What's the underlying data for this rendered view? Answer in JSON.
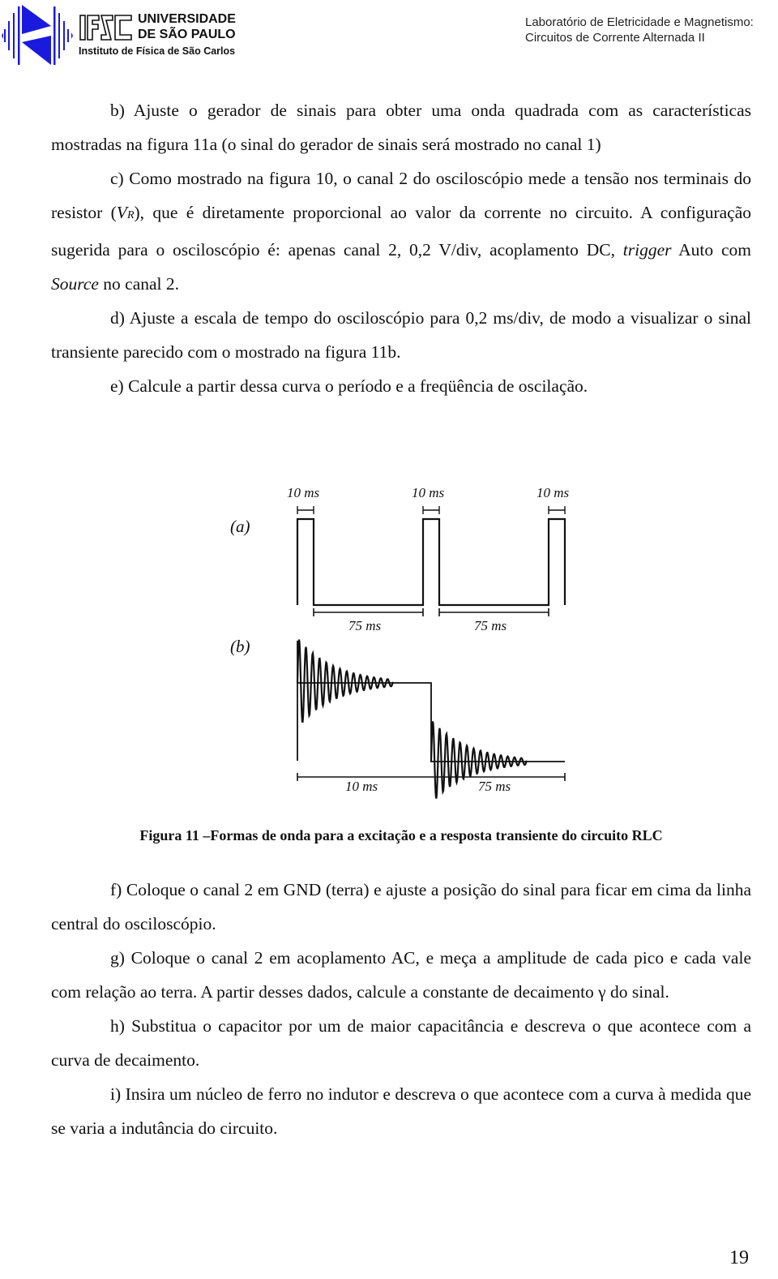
{
  "header": {
    "logo": {
      "acronym": "IFSC",
      "line1": "UNIVERSIDADE",
      "line2": "DE SÃO PAULO",
      "line3": "Instituto de Física de São Carlos",
      "color": "#1a1adf"
    },
    "course_line1": "Laboratório de Eletricidade e Magnetismo:",
    "course_line2": "Circuitos de Corrente Alternada II"
  },
  "paragraphs_top": {
    "b": "b) Ajuste o gerador de sinais para obter uma onda quadrada com as características mostradas na figura 11a (o sinal do gerador de sinais será mostrado no canal 1)",
    "c_pre": "c) Como mostrado na figura 10, o canal 2 do osciloscópio mede a tensão nos terminais do resistor (",
    "c_var": "V",
    "c_sub": "R",
    "c_mid": "), que é diretamente proporcional ao valor da corrente no circuito. A configuração sugerida para o osciloscópio é: apenas canal 2, 0,2 V/div, acoplamento DC, ",
    "c_trigger": "trigger",
    "c_mid2": " Auto com ",
    "c_source": "Source",
    "c_end": " no canal 2.",
    "d": "d) Ajuste a escala de tempo do osciloscópio para 0,2 ms/div, de modo a visualizar o sinal transiente parecido com o mostrado na figura 11b.",
    "e": "e) Calcule a partir dessa curva o período e a freqüência de oscilação."
  },
  "figure": {
    "label_a": "(a)",
    "label_b": "(b)",
    "pulse_width_label": "10 ms",
    "low_width_label": "75 ms",
    "bottom_left_label": "10 ms",
    "bottom_right_label": "75 ms",
    "caption": "Figura 11 –Formas de onda para a excitação e a resposta transiente do circuito RLC"
  },
  "paragraphs_bottom": {
    "f": "f) Coloque o canal 2 em GND (terra) e ajuste a posição do sinal para ficar em cima da linha central do osciloscópio.",
    "g": "g) Coloque o canal 2 em acoplamento AC, e meça a amplitude de cada pico e cada vale com relação ao terra. A partir desses dados, calcule a constante de decaimento γ do sinal.",
    "h": "h) Substitua o capacitor por um de maior capacitância e descreva o que acontece com a curva de decaimento.",
    "i": "i) Insira um núcleo de ferro no indutor e descreva o que acontece com a curva à medida que se varia a indutância do circuito."
  },
  "page_number": "19"
}
